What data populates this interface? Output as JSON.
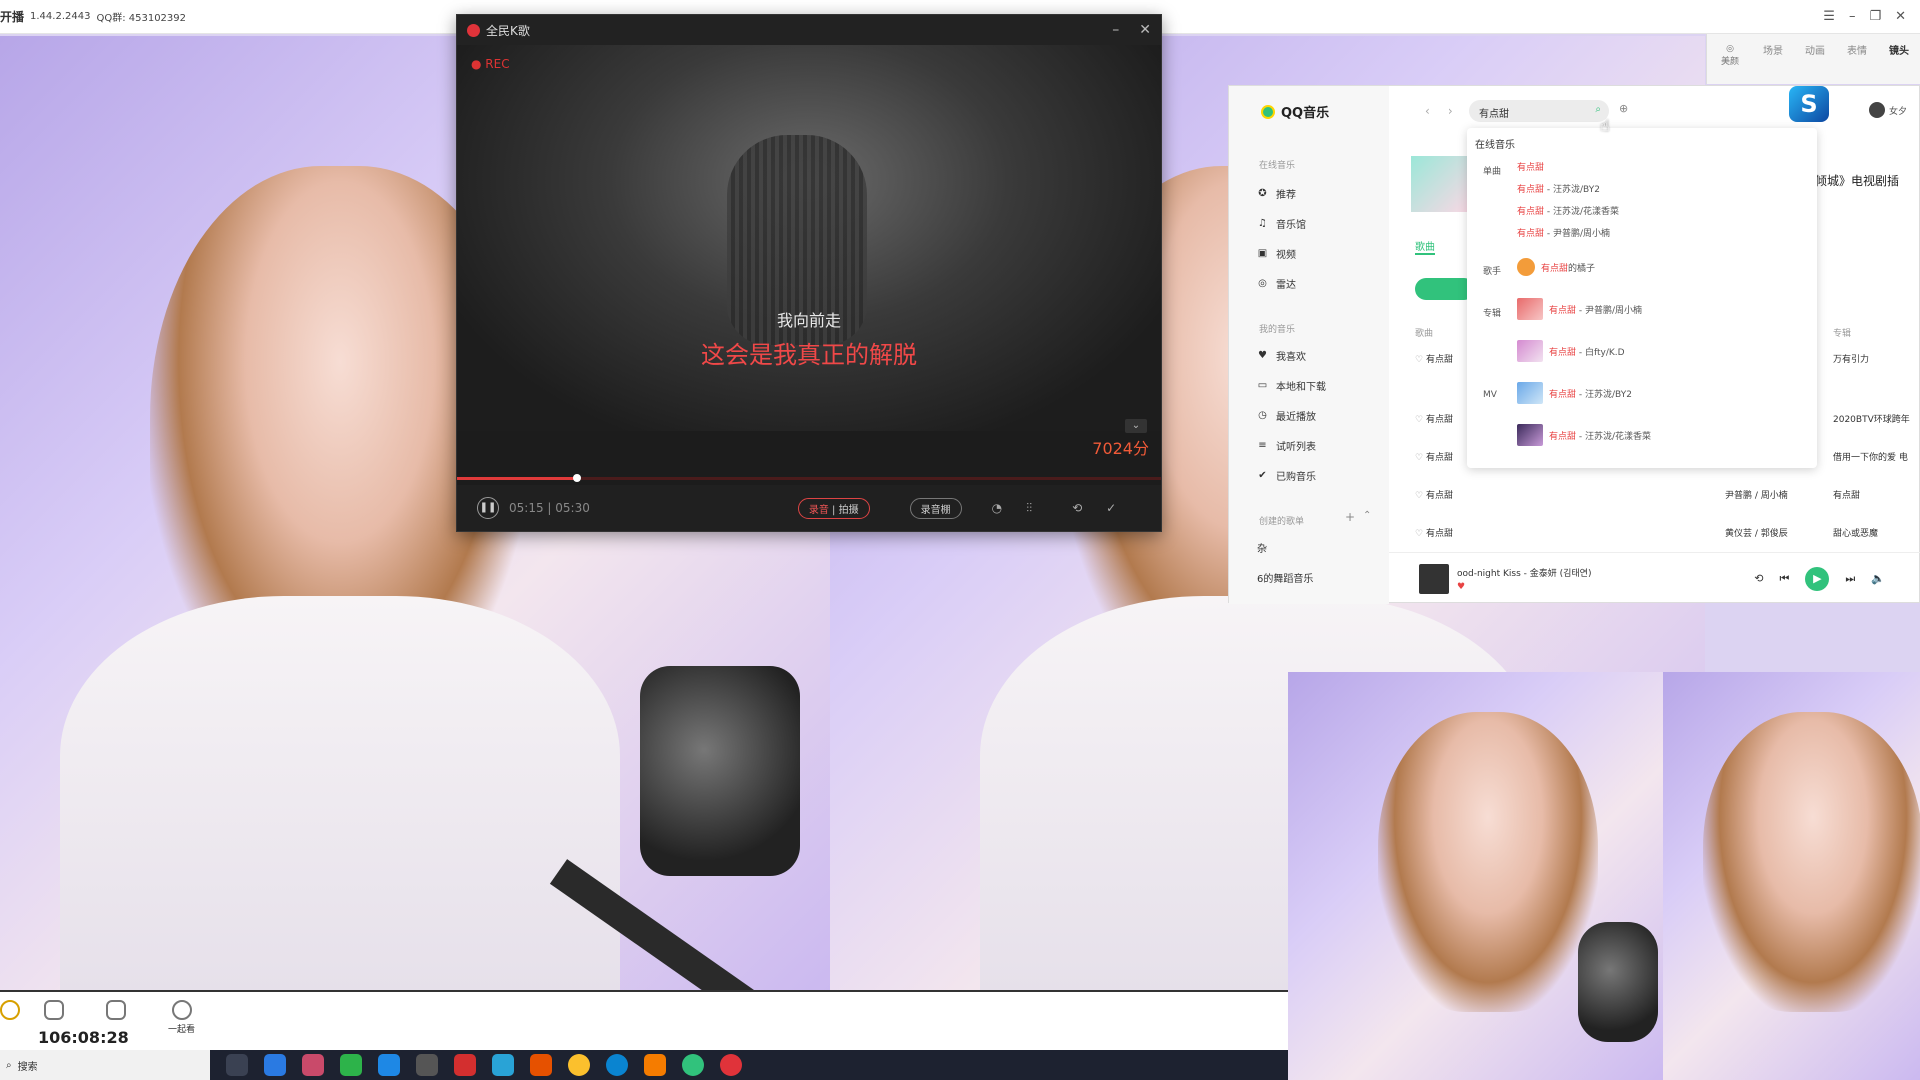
{
  "topbar": {
    "title": "开播",
    "version": "1.44.2.2443",
    "qq": "QQ群: 453102392",
    "right_tabs": [
      "场景",
      "动画",
      "表情",
      "镜头"
    ],
    "right_tab_meiyan": "美颜"
  },
  "karaoke": {
    "title": "全民K歌",
    "rec_label": "REC",
    "lyric_prev": "我向前走",
    "lyric_current": "这会是我真正的解脱",
    "score": "7024分",
    "time": "05:15 | 05:30",
    "progress_fraction": 0.17,
    "buttons": {
      "record": "录音",
      "shoot": "拍摄",
      "tone": "录音棚"
    }
  },
  "qqmusic": {
    "brand": "QQ音乐",
    "search_query": "有点甜",
    "sections": {
      "online": "在线音乐",
      "mine": "我的音乐",
      "created": "创建的歌单"
    },
    "nav_online": [
      "推荐",
      "音乐馆",
      "视频",
      "雷达"
    ],
    "nav_mine": [
      "我喜欢",
      "本地和下载",
      "最近播放",
      "试听列表",
      "已购音乐"
    ],
    "playlists": [
      "杂",
      "6的舞蹈音乐"
    ],
    "tabs": [
      "歌曲"
    ],
    "col_song": "歌曲",
    "col_album": "专辑",
    "banner_text": "倾城》电视剧插",
    "dropdown": {
      "header": "在线音乐",
      "cat_single": "单曲",
      "cat_singer": "歌手",
      "cat_album": "专辑",
      "cat_mv": "MV",
      "singles": [
        {
          "hl": "有点甜",
          "rest": ""
        },
        {
          "hl": "有点甜",
          "rest": " - 汪苏泷/BY2"
        },
        {
          "hl": "有点甜",
          "rest": " - 汪苏泷/花漾香菜"
        },
        {
          "hl": "有点甜",
          "rest": " - 尹普鹏/周小楠"
        }
      ],
      "singer": {
        "hl": "有点甜",
        "rest": "的橘子"
      },
      "albums": [
        {
          "hl": "有点甜",
          "rest": " - 尹普鹏/周小楠"
        },
        {
          "hl": "有点甜",
          "rest": " - 白fty/K.D"
        }
      ],
      "mvs": [
        {
          "hl": "有点甜",
          "rest": " - 汪苏泷/BY2"
        },
        {
          "hl": "有点甜",
          "rest": " - 汪苏泷/花漾香菜"
        }
      ]
    },
    "song_rows": [
      {
        "title": "有点甜",
        "artist": "",
        "album": "万有引力"
      },
      {
        "title": "有点甜",
        "artist": "",
        "album": "2020BTV环球跨年"
      },
      {
        "title": "有点甜",
        "artist": "",
        "album": "借用一下你的爱 电"
      },
      {
        "title": "有点甜",
        "artist": "尹普鹏 / 周小楠",
        "album": "有点甜"
      },
      {
        "title": "有点甜",
        "artist": "黄仪芸 / 郭俊辰",
        "album": "甜心或恶魔"
      }
    ],
    "now_playing": "ood-night Kiss - 金泰妍 (김태연)",
    "user": "女夕"
  },
  "bottombar": {
    "items": [
      "",
      "一起看"
    ],
    "timer": "106:08:28"
  },
  "taskbar": {
    "search": "搜索"
  },
  "colors": {
    "qq_green": "#31c27c",
    "kge_red": "#e03a3a",
    "highlight": "#e84343"
  }
}
